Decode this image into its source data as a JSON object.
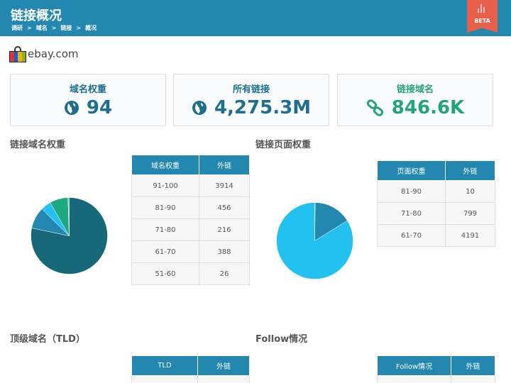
{
  "header": {
    "title": "链接概况",
    "breadcrumb": [
      "调研",
      "域名",
      "链接",
      "概况"
    ],
    "sep": ">",
    "beta_label": "BETA"
  },
  "site": {
    "domain": "ebay.com"
  },
  "cards": [
    {
      "label": "域名权重",
      "value": "94",
      "icon": "globe-icon",
      "color": "#1d6e8f"
    },
    {
      "label": "所有链接",
      "value": "4,275.3M",
      "icon": "globe-icon",
      "color": "#1d6e8f"
    },
    {
      "label": "链接域名",
      "value": "846.6K",
      "icon": "chain-link-icon",
      "color": "#23a37b"
    }
  ],
  "sections": {
    "domain_rank": {
      "title": "链接域名权重",
      "columns": [
        "域名权重",
        "外链"
      ],
      "rows": [
        [
          "91-100",
          "3914"
        ],
        [
          "81-90",
          "456"
        ],
        [
          "71-80",
          "216"
        ],
        [
          "61-70",
          "388"
        ],
        [
          "51-60",
          "26"
        ]
      ],
      "colors": [
        "#176878",
        "#2387b0",
        "#22c1ef",
        "#1fa87f",
        "#77c8a7"
      ]
    },
    "page_rank": {
      "title": "链接页面权重",
      "columns": [
        "页面权重",
        "外链"
      ],
      "rows": [
        [
          "81-90",
          "10"
        ],
        [
          "71-80",
          "799"
        ],
        [
          "61-70",
          "4191"
        ]
      ],
      "colors": [
        "#176878",
        "#2387b0",
        "#22c1ef"
      ]
    },
    "tld": {
      "title": "顶级域名（TLD）",
      "columns": [
        "TLD",
        "外链"
      ]
    },
    "follow": {
      "title": "Follow情况",
      "columns": [
        "Follow情况",
        "外链"
      ]
    }
  },
  "chart_data": [
    {
      "type": "pie",
      "categories": [
        "91-100",
        "81-90",
        "71-80",
        "61-70",
        "51-60"
      ],
      "values": [
        3914,
        456,
        216,
        388,
        26
      ]
    },
    {
      "type": "pie",
      "categories": [
        "81-90",
        "71-80",
        "61-70"
      ],
      "values": [
        10,
        799,
        4191
      ]
    }
  ]
}
